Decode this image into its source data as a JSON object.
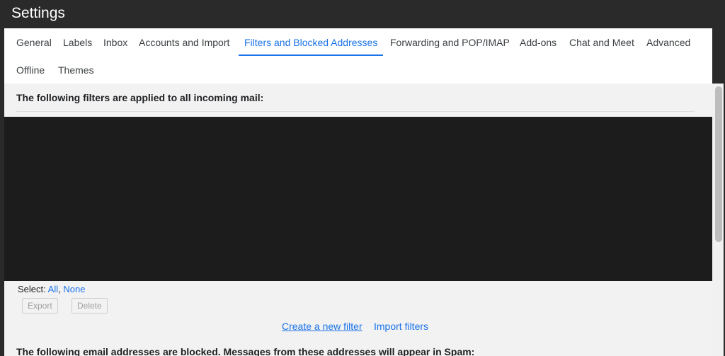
{
  "window": {
    "title": "Settings"
  },
  "tabs": [
    {
      "label": "General"
    },
    {
      "label": "Labels"
    },
    {
      "label": "Inbox"
    },
    {
      "label": "Accounts and Import"
    },
    {
      "label": "Filters and Blocked Addresses",
      "active": true
    },
    {
      "label": "Forwarding and POP/IMAP"
    },
    {
      "label": "Add-ons"
    },
    {
      "label": "Chat and Meet"
    },
    {
      "label": "Advanced"
    },
    {
      "label": "Offline"
    },
    {
      "label": "Themes"
    }
  ],
  "filters": {
    "heading": "The following filters are applied to all incoming mail:",
    "select_label": "Select:",
    "select_all": "All",
    "select_separator": ",",
    "select_none": "None",
    "export_label": "Export",
    "delete_label": "Delete",
    "create_filter": "Create a new filter",
    "import_filters": "Import filters"
  },
  "blocked": {
    "heading": "The following email addresses are blocked. Messages from these addresses will appear in Spam:"
  },
  "colors": {
    "accent": "#1a73e8",
    "titlebar": "#2a2a2a",
    "panel": "#f2f2f2",
    "redacted_block": "#1c1c1c"
  }
}
